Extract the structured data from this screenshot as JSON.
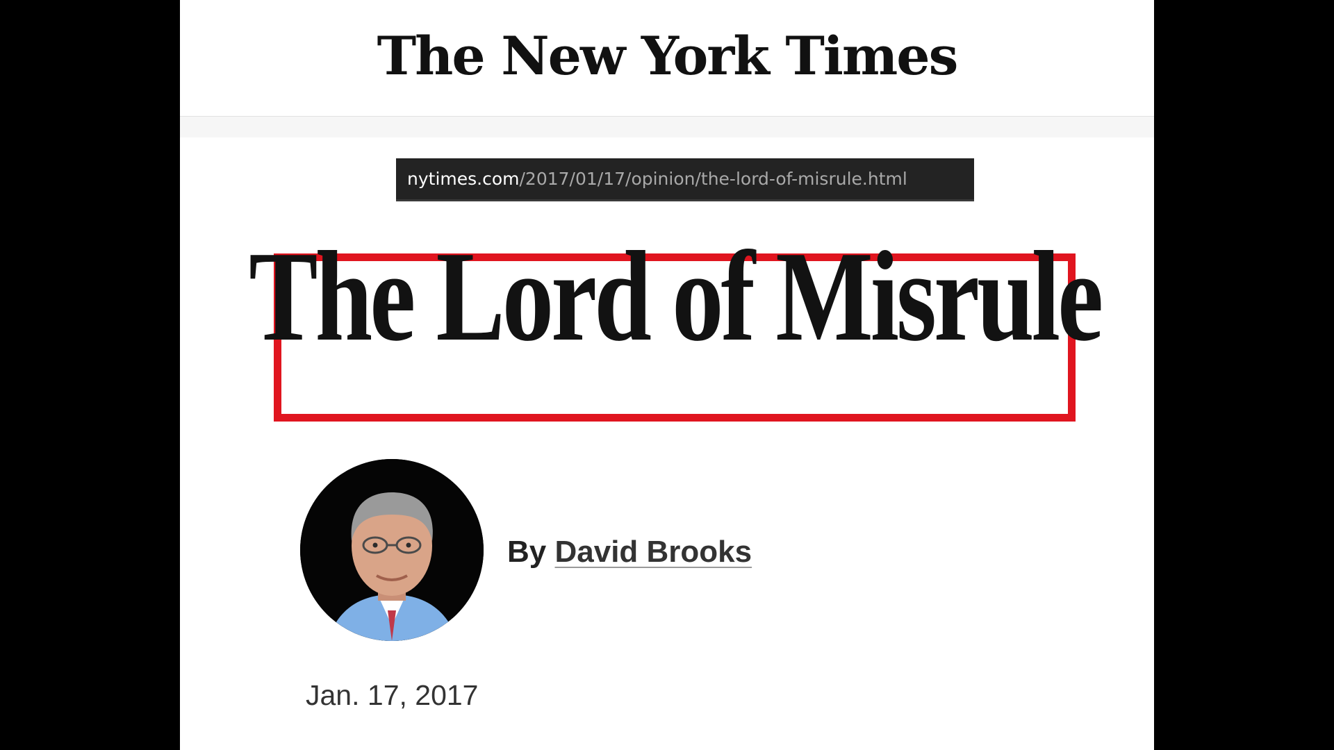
{
  "masthead": {
    "logo_text": "The New York Times"
  },
  "url_bar": {
    "domain": "nytimes.com",
    "path": "/2017/01/17/opinion/the-lord-of-misrule.html"
  },
  "article": {
    "headline": "The Lord of Misrule",
    "byline_prefix": "By ",
    "author": "David Brooks",
    "date": "Jan. 17, 2017",
    "highlight_color": "#e0151f"
  },
  "colors": {
    "page_background": "#ffffff",
    "outer_background": "#000000",
    "url_bar_background": "#232323",
    "url_path_text": "#a9a9a9"
  }
}
